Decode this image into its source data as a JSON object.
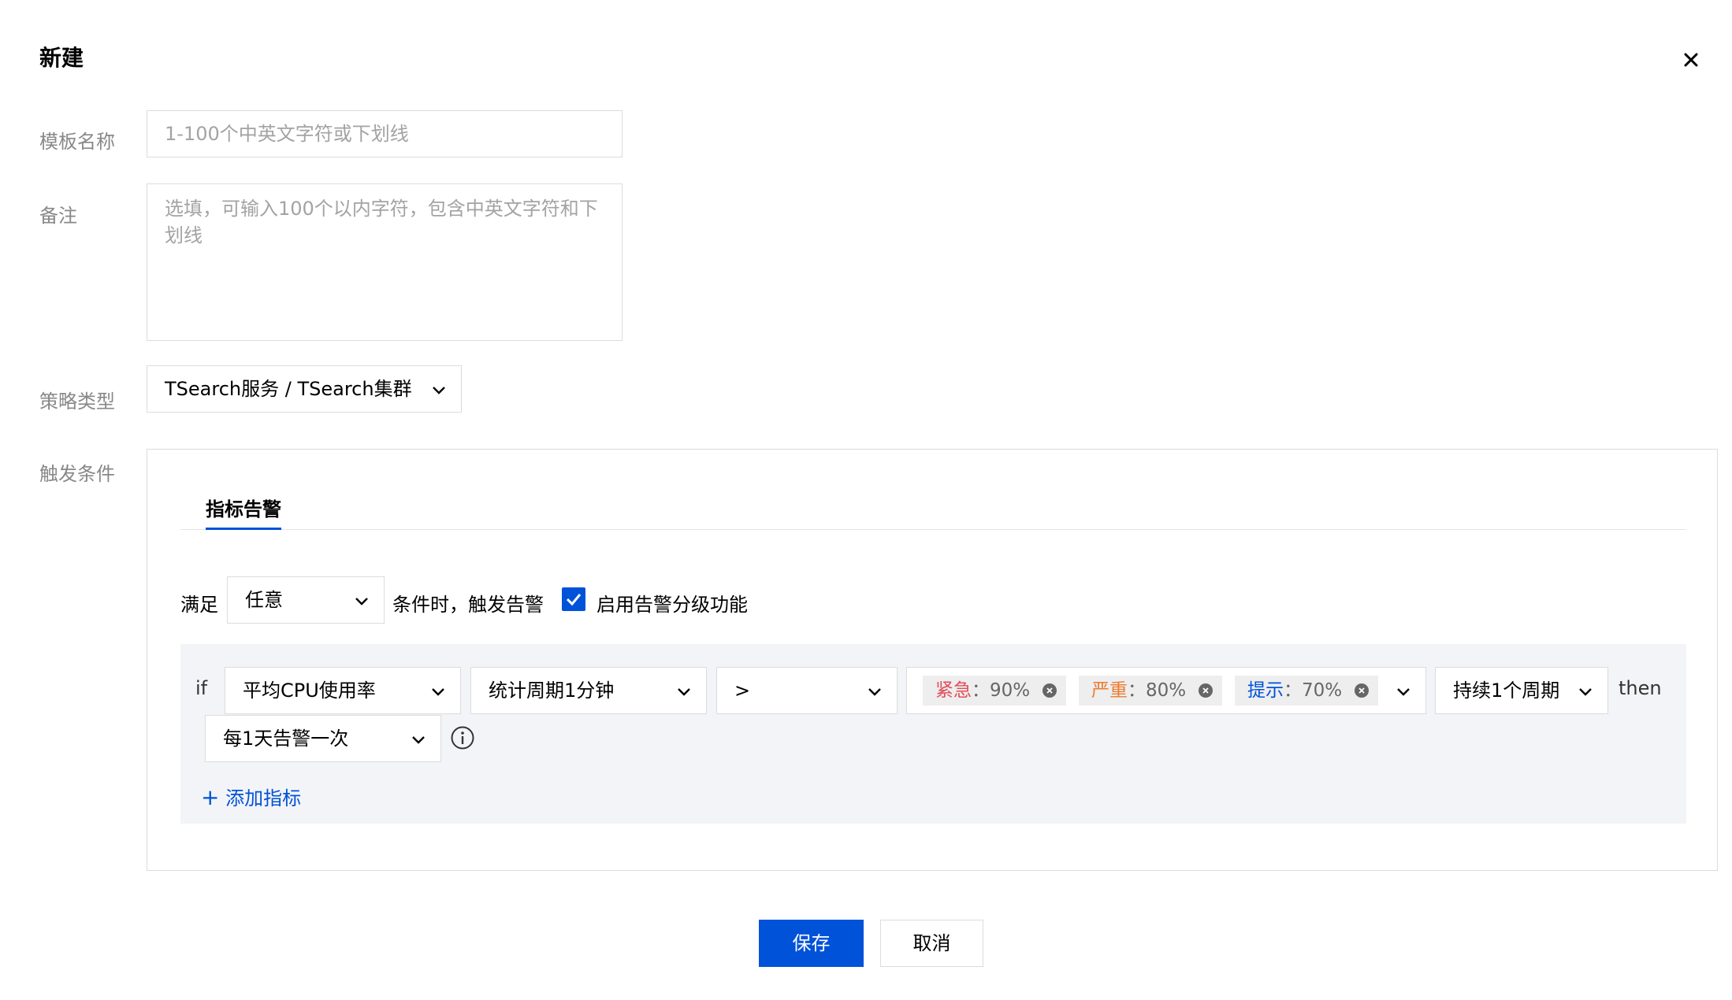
{
  "dialog": {
    "title": "新建"
  },
  "form": {
    "template_name": {
      "label": "模板名称",
      "placeholder": "1-100个中英文字符或下划线"
    },
    "remark": {
      "label": "备注",
      "placeholder": "选填，可输入100个以内字符，包含中英文字符和下划线"
    },
    "policy_type": {
      "label": "策略类型",
      "value": "TSearch服务 / TSearch集群"
    },
    "trigger": {
      "label": "触发条件"
    }
  },
  "trigger": {
    "tab_label": "指标告警",
    "satisfy_label": "满足",
    "satisfy_value": "任意",
    "condition_text": "条件时，触发告警",
    "level_enabled": true,
    "level_label": "启用告警分级功能",
    "rule": {
      "if_label": "if",
      "metric": "平均CPU使用率",
      "period": "统计周期1分钟",
      "operator": ">",
      "thresholds": [
        {
          "level": "紧急",
          "separator": "：",
          "value": "90%",
          "color": "#e34d59"
        },
        {
          "level": "严重",
          "separator": "：",
          "value": "80%",
          "color": "#ed7b2f"
        },
        {
          "level": "提示",
          "separator": "：",
          "value": "70%",
          "color": "#0052d9"
        }
      ],
      "duration": "持续1个周期",
      "then_label": "then",
      "frequency": "每1天告警一次"
    },
    "add_metric_label": "添加指标"
  },
  "footer": {
    "save_label": "保存",
    "cancel_label": "取消"
  },
  "colors": {
    "primary": "#0052d9",
    "urgent": "#e34d59",
    "serious": "#ed7b2f",
    "hint": "#0052d9"
  }
}
